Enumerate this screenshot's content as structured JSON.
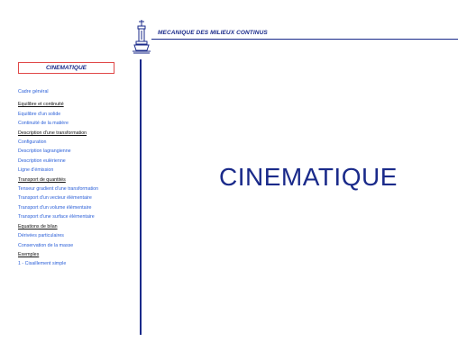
{
  "header": {
    "title": "MECANIQUE DES MILIEUX CONTINUS",
    "logo_icon": "monument-logo-icon"
  },
  "sidebar": {
    "section_title": "CINEMATIQUE",
    "items": [
      {
        "label": "Cadre général",
        "type": "link"
      },
      {
        "label": "Equilibre et continuité",
        "type": "heading"
      },
      {
        "label": "Equilibre d'un solide",
        "type": "link"
      },
      {
        "label": "Continuité de la matière",
        "type": "link"
      },
      {
        "label": "Description d'une transformation",
        "type": "heading"
      },
      {
        "label": "Configuration",
        "type": "link"
      },
      {
        "label": "Description lagrangienne",
        "type": "link"
      },
      {
        "label": "Description eulérienne",
        "type": "link"
      },
      {
        "label": "Ligne d'émission",
        "type": "link"
      },
      {
        "label": "Transport de quantités",
        "type": "heading"
      },
      {
        "label": "Tenseur gradient d'une transformation",
        "type": "link"
      },
      {
        "label": "Transport d'un vecteur élémentaire",
        "type": "link"
      },
      {
        "label": "Transport d'un volume élémentaire",
        "type": "link"
      },
      {
        "label": "Transport d'une surface élémentaire",
        "type": "link"
      },
      {
        "label": "Equations de bilan",
        "type": "heading"
      },
      {
        "label": "Dérivées particulaires",
        "type": "link"
      },
      {
        "label": "Conservation de la masse",
        "type": "link"
      },
      {
        "label": "Exemples",
        "type": "heading"
      },
      {
        "label": "1 - Cisaillement simple",
        "type": "link"
      }
    ]
  },
  "main": {
    "title": "CINEMATIQUE"
  },
  "colors": {
    "title_blue": "#1a2a8a",
    "link_blue": "#2a5fd8",
    "box_border": "#e04848"
  }
}
